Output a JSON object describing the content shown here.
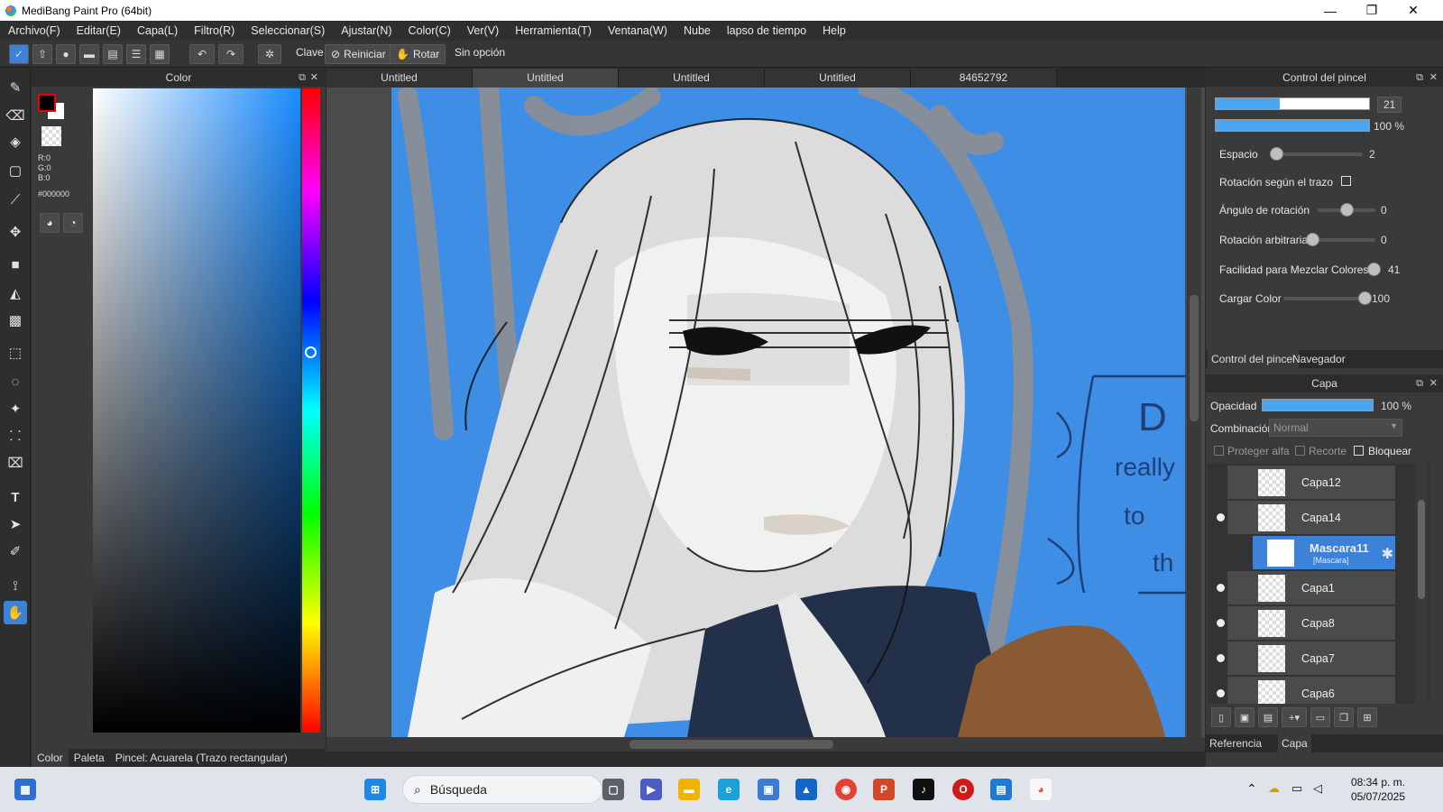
{
  "window": {
    "title": "MediBang Paint Pro (64bit)",
    "minimize": "—",
    "maximize": "❐",
    "close": "✕"
  },
  "menu": [
    "Archivo(F)",
    "Editar(E)",
    "Capa(L)",
    "Filtro(R)",
    "Seleccionar(S)",
    "Ajustar(N)",
    "Color(C)",
    "Ver(V)",
    "Herramienta(T)",
    "Ventana(W)",
    "Nube",
    "lapso de tiempo",
    "Help"
  ],
  "toolbar": {
    "clave": "Clave",
    "reiniciar": "Reiniciar",
    "rotar": "Rotar",
    "sin_opcion": "Sin opción"
  },
  "color_panel": {
    "title": "Color",
    "r": "R:0",
    "g": "G:0",
    "b": "B:0",
    "hex": "#000000",
    "tabs": [
      "Color",
      "Paleta"
    ],
    "status": "Pincel: Acuarela (Trazo rectangular)"
  },
  "doc_tabs": [
    "Untitled",
    "Untitled",
    "Untitled",
    "Untitled",
    "84652792"
  ],
  "brush_panel": {
    "title": "Control del pincel",
    "size": "21",
    "size_fraction": 0.42,
    "opacity": "100 %",
    "opacity_fraction": 1.0,
    "settings": [
      {
        "label": "Espacio",
        "value": "2",
        "fraction": 0.02
      },
      {
        "label": "Rotación según el trazo",
        "checkbox": true
      },
      {
        "label": "Ángulo de rotación",
        "value": "0",
        "fraction": 0.5
      },
      {
        "label": "Rotación arbitraria",
        "value": "0",
        "fraction": 0.0
      },
      {
        "label": "Facilidad para Mezclar Colores",
        "value": "41",
        "fraction": 0.41
      },
      {
        "label": "Cargar Color",
        "value": "100",
        "fraction": 1.0
      }
    ],
    "tabs": [
      "Control del pincel",
      "Navegador"
    ]
  },
  "layer_panel": {
    "title": "Capa",
    "opacity_label": "Opacidad",
    "opacity": "100 %",
    "blend_label": "Combinación",
    "blend": "Normal",
    "protect_alpha": "Proteger alfa",
    "clip": "Recorte",
    "lock": "Bloquear",
    "layers": [
      "Capa12",
      "Capa14",
      "Mascara11",
      "Capa1",
      "Capa8",
      "Capa7",
      "Capa6"
    ],
    "mask_sub": "[Mascara]",
    "tabs": [
      "Referencia",
      "Capa"
    ]
  },
  "canvas_text": {
    "t1": "D",
    "t2": "really",
    "t3": "to",
    "t4": "th"
  },
  "taskbar": {
    "search": "Búsqueda",
    "time": "08:34 p. m.",
    "date": "05/07/2025"
  }
}
